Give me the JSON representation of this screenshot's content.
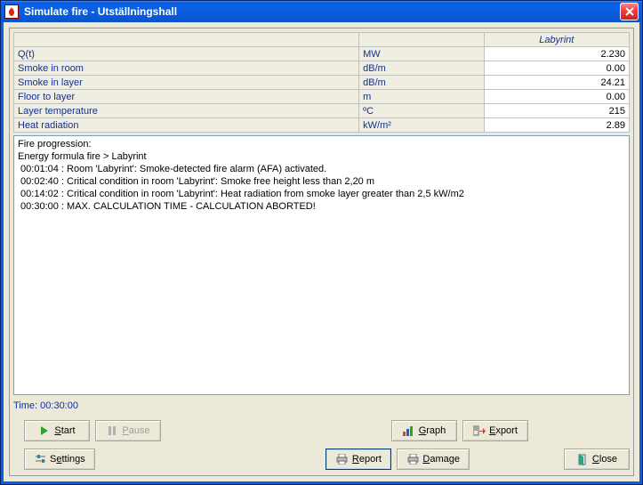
{
  "window": {
    "title": "Simulate fire - Utställningshall"
  },
  "table": {
    "column_header": "Labyrint",
    "rows": [
      {
        "label": "Q(t)",
        "unit": "MW",
        "value": "2.230"
      },
      {
        "label": "Smoke in room",
        "unit": "dB/m",
        "value": "0.00"
      },
      {
        "label": "Smoke in layer",
        "unit": "dB/m",
        "value": "24.21"
      },
      {
        "label": "Floor to layer",
        "unit": "m",
        "value": "0.00"
      },
      {
        "label": "Layer temperature",
        "unit": "ºC",
        "value": "215"
      },
      {
        "label": "Heat radiation",
        "unit": "kW/m²",
        "value": "2.89"
      }
    ]
  },
  "log": {
    "header1": "Fire progression:",
    "header2": "Energy formula fire > Labyrint",
    "lines": [
      " 00:01:04 : Room 'Labyrint': Smoke-detected fire alarm (AFA) activated.",
      " 00:02:40 : Critical condition in room 'Labyrint': Smoke free height less than 2,20 m",
      " 00:14:02 : Critical condition in room 'Labyrint': Heat radiation from smoke layer greater than 2,5 kW/m2",
      " 00:30:00 : MAX. CALCULATION TIME - CALCULATION ABORTED!"
    ]
  },
  "time": {
    "label": "Time:",
    "value": "00:30:00"
  },
  "buttons": {
    "start": "Start",
    "pause": "Pause",
    "graph": "Graph",
    "export": "Export",
    "settings": "Settings",
    "report": "Report",
    "damage": "Damage",
    "close": "Close"
  }
}
